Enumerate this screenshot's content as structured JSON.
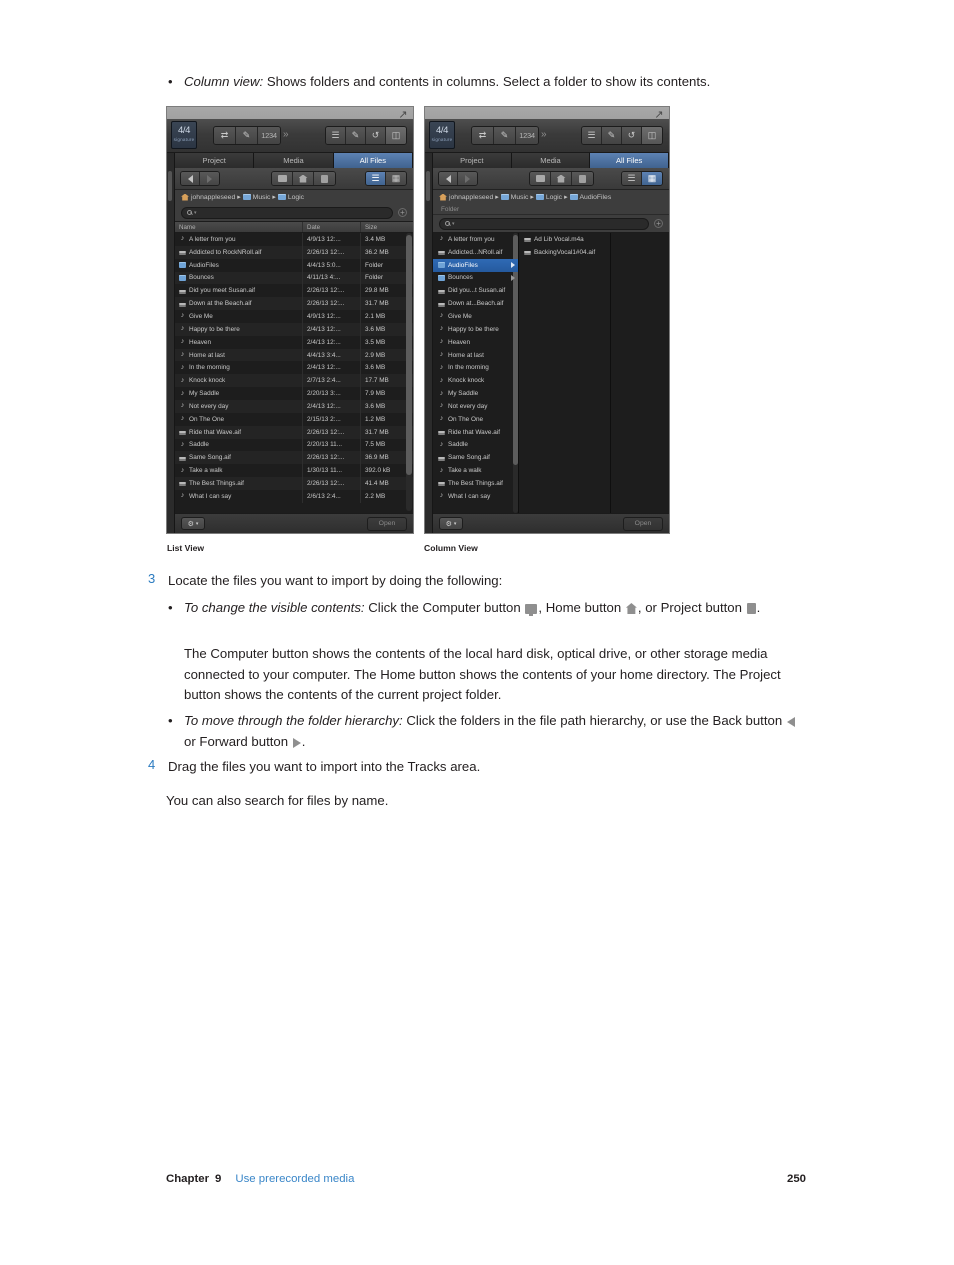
{
  "intro_bullet": {
    "italic": "Column view:",
    "rest": " Shows folders and contents in columns. Select a folder to show its contents."
  },
  "accent_blue": "#2b7bc0",
  "selection_blue": "#2f6ab5",
  "panels": {
    "list": {
      "caption": "List View",
      "signature": {
        "value": "4/4",
        "label": "signature"
      },
      "transport_icons": [
        "cycle-icon",
        "pencil-icon",
        "1234-icon"
      ],
      "overflow": "»",
      "view_icons": [
        "list-icon",
        "notepad-icon",
        "loop-icon",
        "browser-icon"
      ],
      "tabs": [
        {
          "label": "Project",
          "active": false
        },
        {
          "label": "Media",
          "active": false
        },
        {
          "label": "All Files",
          "active": true
        }
      ],
      "nav": {
        "back": "back-arrow",
        "forward": "forward-arrow"
      },
      "location_buttons": [
        "computer-icon",
        "home-icon",
        "project-icon"
      ],
      "view_toggle": {
        "list_active": true,
        "column_active": false
      },
      "breadcrumbs": [
        "johnappleseed",
        "Music",
        "Logic"
      ],
      "subcrumb": "",
      "search_placeholder": "",
      "columns": [
        "Name",
        "Date",
        "Size"
      ],
      "files": [
        {
          "name": "A letter from you",
          "date": "4/9/13 12:...",
          "size": "3.4 MB",
          "icon": "audio-note"
        },
        {
          "name": "Addicted to RockNRoll.aif",
          "date": "2/26/13 12:...",
          "size": "36.2 MB",
          "icon": "audio-wave"
        },
        {
          "name": "AudioFiles",
          "date": "4/4/13 5:0...",
          "size": "Folder",
          "icon": "folder"
        },
        {
          "name": "Bounces",
          "date": "4/11/13 4:...",
          "size": "Folder",
          "icon": "folder"
        },
        {
          "name": "Did you meet Susan.aif",
          "date": "2/26/13 12:...",
          "size": "29.8 MB",
          "icon": "audio-wave"
        },
        {
          "name": "Down at the Beach.aif",
          "date": "2/26/13 12:...",
          "size": "31.7 MB",
          "icon": "audio-wave"
        },
        {
          "name": "Give Me",
          "date": "4/9/13 12:...",
          "size": "2.1 MB",
          "icon": "audio-note"
        },
        {
          "name": "Happy to be there",
          "date": "2/4/13 12:...",
          "size": "3.6 MB",
          "icon": "audio-note"
        },
        {
          "name": "Heaven",
          "date": "2/4/13 12:...",
          "size": "3.5 MB",
          "icon": "audio-note"
        },
        {
          "name": "Home at last",
          "date": "4/4/13 3:4...",
          "size": "2.9 MB",
          "icon": "audio-note"
        },
        {
          "name": "In the morning",
          "date": "2/4/13 12:...",
          "size": "3.6 MB",
          "icon": "audio-note"
        },
        {
          "name": "Knock knock",
          "date": "2/7/13 2:4...",
          "size": "17.7 MB",
          "icon": "audio-note"
        },
        {
          "name": "My Saddle",
          "date": "2/20/13 3:...",
          "size": "7.9 MB",
          "icon": "audio-note"
        },
        {
          "name": "Not every day",
          "date": "2/4/13 12:...",
          "size": "3.6 MB",
          "icon": "audio-note"
        },
        {
          "name": "On The One",
          "date": "2/15/13 2:...",
          "size": "1.2 MB",
          "icon": "audio-note"
        },
        {
          "name": "Ride that Wave.aif",
          "date": "2/26/13 12:...",
          "size": "31.7 MB",
          "icon": "audio-wave"
        },
        {
          "name": "Saddle",
          "date": "2/20/13 11...",
          "size": "7.5 MB",
          "icon": "audio-note"
        },
        {
          "name": "Same Song.aif",
          "date": "2/26/13 12:...",
          "size": "36.9 MB",
          "icon": "audio-wave"
        },
        {
          "name": "Take a walk",
          "date": "1/30/13 11...",
          "size": "392.0 kB",
          "icon": "audio-note"
        },
        {
          "name": "The Best Things.aif",
          "date": "2/26/13 12:...",
          "size": "41.4 MB",
          "icon": "audio-wave"
        },
        {
          "name": "What I can say",
          "date": "2/6/13 2:4...",
          "size": "2.2 MB",
          "icon": "audio-note"
        }
      ],
      "bottom": {
        "gear": "⚙",
        "open": "Open"
      }
    },
    "column": {
      "caption": "Column View",
      "signature": {
        "value": "4/4",
        "label": "signature"
      },
      "transport_icons": [
        "cycle-icon",
        "pencil-icon",
        "1234-icon"
      ],
      "overflow": "»",
      "view_icons": [
        "list-icon",
        "notepad-icon",
        "loop-icon",
        "browser-icon"
      ],
      "tabs": [
        {
          "label": "Project",
          "active": false
        },
        {
          "label": "Media",
          "active": false
        },
        {
          "label": "All Files",
          "active": true
        }
      ],
      "location_buttons": [
        "computer-icon",
        "home-icon",
        "project-icon"
      ],
      "view_toggle": {
        "list_active": false,
        "column_active": true
      },
      "breadcrumbs": [
        "johnappleseed",
        "Music",
        "Logic",
        "AudioFiles"
      ],
      "subcrumb": "Folder",
      "col1": [
        {
          "name": "A letter from you",
          "icon": "audio-note",
          "selected": false,
          "arrow": false
        },
        {
          "name": "Addicted...NRoll.aif",
          "icon": "audio-wave",
          "selected": false,
          "arrow": false
        },
        {
          "name": "AudioFiles",
          "icon": "folder",
          "selected": true,
          "arrow": true
        },
        {
          "name": "Bounces",
          "icon": "folder",
          "selected": false,
          "arrow": true
        },
        {
          "name": "Did you...t Susan.aif",
          "icon": "audio-wave",
          "selected": false,
          "arrow": false
        },
        {
          "name": "Down at...Beach.aif",
          "icon": "audio-wave",
          "selected": false,
          "arrow": false
        },
        {
          "name": "Give Me",
          "icon": "audio-note",
          "selected": false,
          "arrow": false
        },
        {
          "name": "Happy to be there",
          "icon": "audio-note",
          "selected": false,
          "arrow": false
        },
        {
          "name": "Heaven",
          "icon": "audio-note",
          "selected": false,
          "arrow": false
        },
        {
          "name": "Home at last",
          "icon": "audio-note",
          "selected": false,
          "arrow": false
        },
        {
          "name": "In the morning",
          "icon": "audio-note",
          "selected": false,
          "arrow": false
        },
        {
          "name": "Knock knock",
          "icon": "audio-note",
          "selected": false,
          "arrow": false
        },
        {
          "name": "My Saddle",
          "icon": "audio-note",
          "selected": false,
          "arrow": false
        },
        {
          "name": "Not every day",
          "icon": "audio-note",
          "selected": false,
          "arrow": false
        },
        {
          "name": "On The One",
          "icon": "audio-note",
          "selected": false,
          "arrow": false
        },
        {
          "name": "Ride that Wave.aif",
          "icon": "audio-wave",
          "selected": false,
          "arrow": false
        },
        {
          "name": "Saddle",
          "icon": "audio-note",
          "selected": false,
          "arrow": false
        },
        {
          "name": "Same Song.aif",
          "icon": "audio-wave",
          "selected": false,
          "arrow": false
        },
        {
          "name": "Take a walk",
          "icon": "audio-note",
          "selected": false,
          "arrow": false
        },
        {
          "name": "The Best Things.aif",
          "icon": "audio-wave",
          "selected": false,
          "arrow": false
        },
        {
          "name": "What I can say",
          "icon": "audio-note",
          "selected": false,
          "arrow": false
        }
      ],
      "col2": [
        {
          "name": "Ad Lib Vocal.m4a",
          "icon": "audio-wave",
          "selected": false,
          "arrow": false
        },
        {
          "name": "BackingVocal1#04.aif",
          "icon": "audio-wave",
          "selected": false,
          "arrow": false
        }
      ],
      "col3": [],
      "bottom": {
        "gear": "⚙",
        "open": "Open"
      }
    }
  },
  "steps": {
    "step3": {
      "number": "3",
      "text": "Locate the files you want to import by doing the following:"
    },
    "step4": {
      "number": "4",
      "text": "Drag the files you want to import into the Tracks area."
    }
  },
  "sub_bullets": {
    "bullet1": {
      "italic": "To change the visible contents:",
      "part1": " Click the Computer button ",
      "part2": ", Home button ",
      "part3": ", or Project button ",
      "part4": "."
    },
    "paragraph1": "The Computer button shows the contents of the local hard disk, optical drive, or other storage media connected to your computer. The Home button shows the contents of your home directory. The Project button shows the contents of the current project folder.",
    "bullet2": {
      "italic": "To move through the folder hierarchy:",
      "part1": " Click the folders in the file path hierarchy, or use the Back button ",
      "part2": " or Forward button ",
      "part3": "."
    },
    "paragraph2": "You can also search for files by name."
  },
  "footer": {
    "chapter_label": "Chapter",
    "chapter_number": "9",
    "chapter_title": "Use prerecorded media",
    "page_number": "250"
  }
}
